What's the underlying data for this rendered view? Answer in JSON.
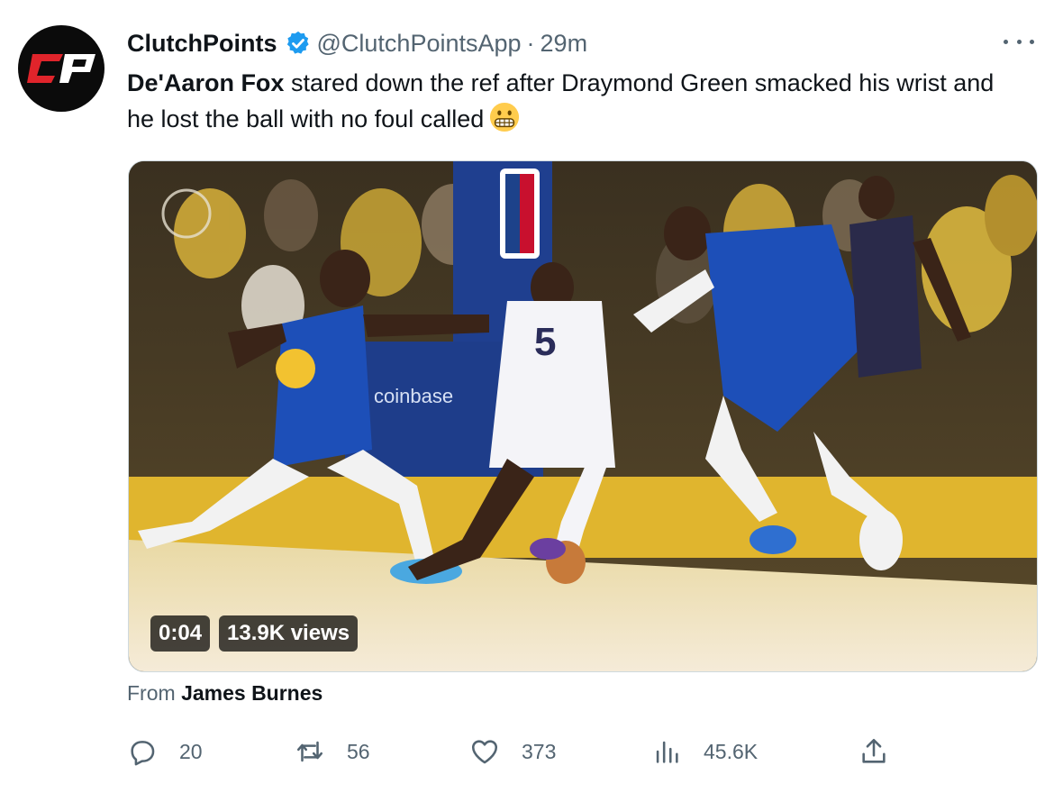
{
  "author": {
    "name": "ClutchPoints",
    "handle": "@ClutchPointsApp",
    "separator": "·",
    "time": "29m",
    "avatar_text": "CP",
    "verified_icon": "verified-badge-icon"
  },
  "tweet": {
    "bold_text": "De'Aaron Fox",
    "text": " stared down the ref after Draymond Green smacked his wrist and he lost the ball with no foul called",
    "emoji": "grimacing-face-emoji"
  },
  "video": {
    "duration": "0:04",
    "views": "13.9K views",
    "scene_text": {
      "jersey_number": "5",
      "court_sponsor": "coinbase"
    }
  },
  "from": {
    "prefix": "From",
    "name": "James Burnes"
  },
  "actions": {
    "replies": "20",
    "retweets": "56",
    "likes": "373",
    "views": "45.6K"
  },
  "colors": {
    "accent": "#1d9bf0",
    "secondary_text": "#536471",
    "brand_red": "#e0242b"
  }
}
